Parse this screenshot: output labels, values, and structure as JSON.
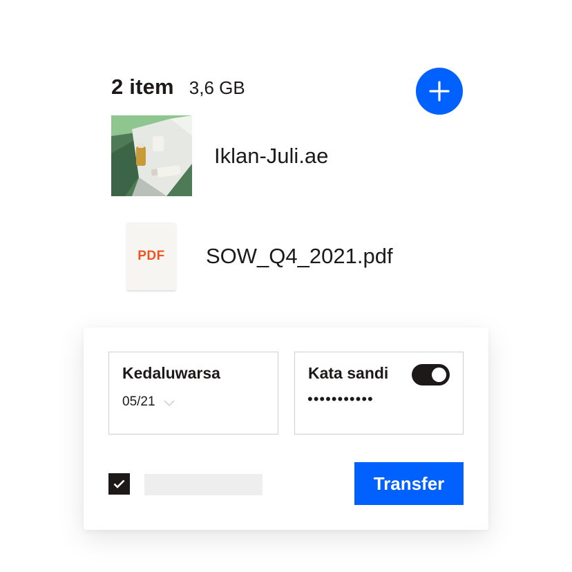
{
  "summary": {
    "count_label": "2 item",
    "total_size": "3,6 GB"
  },
  "add_button": {
    "icon": "plus-icon"
  },
  "files": [
    {
      "name": "Iklan-Juli.ae",
      "thumbnail": "image-thumbnail"
    },
    {
      "name": "SOW_Q4_2021.pdf",
      "icon": "pdf-file-icon",
      "icon_label": "PDF"
    }
  ],
  "options": {
    "expiry": {
      "title": "Kedaluwarsa",
      "value": "05/21"
    },
    "password": {
      "title": "Kata sandi",
      "value": "•••••••••••",
      "toggle_on": true
    }
  },
  "footer": {
    "checkbox_checked": true,
    "transfer_label": "Transfer"
  },
  "colors": {
    "accent": "#0061fe",
    "pdf": "#f0531f",
    "ink": "#1e1919"
  }
}
